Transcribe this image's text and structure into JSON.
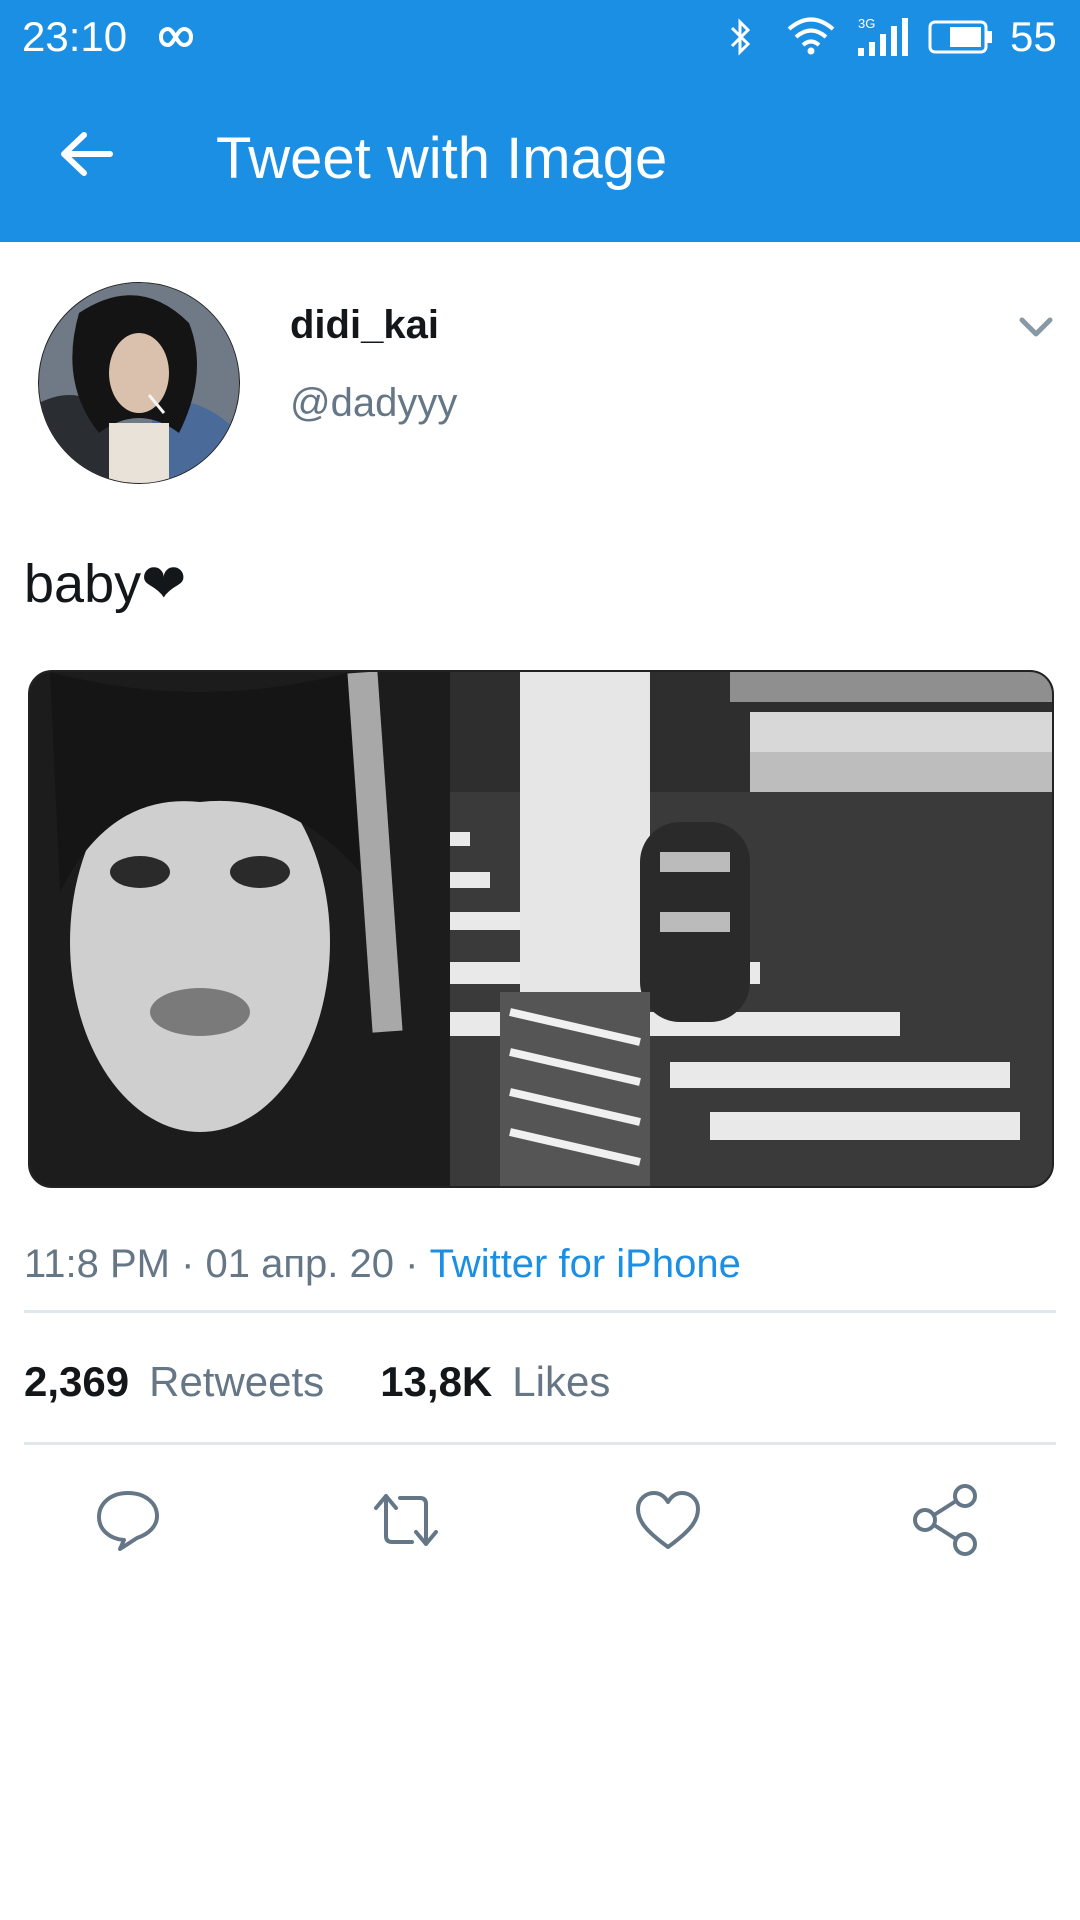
{
  "status_bar": {
    "time": "23:10",
    "battery_level": "55",
    "icons": [
      "infinity-icon",
      "bluetooth-icon",
      "wifi-icon",
      "signal-3g-icon",
      "battery-icon"
    ]
  },
  "app_bar": {
    "title": "Tweet with Image",
    "back_icon": "arrow-left-icon"
  },
  "tweet": {
    "display_name": "didi_kai",
    "handle": "@dadyyy",
    "text": "baby❤",
    "time": "11:8 PM",
    "separator": " · ",
    "date": "01 апр. 20",
    "source": "Twitter for iPhone",
    "retweets_count": "2,369",
    "retweets_label": "Retweets",
    "likes_count": "13,8K",
    "likes_label": "Likes"
  },
  "actions": [
    {
      "name": "reply",
      "icon": "speech-bubble-icon"
    },
    {
      "name": "retweet",
      "icon": "retweet-icon"
    },
    {
      "name": "like",
      "icon": "heart-icon"
    },
    {
      "name": "share",
      "icon": "share-icon"
    }
  ],
  "colors": {
    "accent": "#1b8fe3",
    "secondary_text": "#657786",
    "divider": "#e1e8ed"
  }
}
